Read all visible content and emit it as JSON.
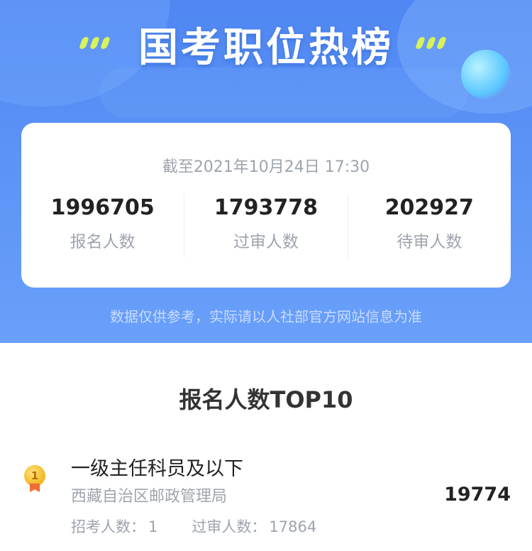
{
  "header": {
    "title": "国考职位热榜"
  },
  "summary": {
    "timestamp": "截至2021年10月24日 17:30",
    "stats": [
      {
        "value": "1996705",
        "label": "报名人数"
      },
      {
        "value": "1793778",
        "label": "过审人数"
      },
      {
        "value": "202927",
        "label": "待审人数"
      }
    ],
    "disclaimer": "数据仅供参考，实际请以人社部官方网站信息为准"
  },
  "ranking": {
    "title": "报名人数TOP10",
    "items": [
      {
        "rank": "1",
        "position": "一级主任科员及以下",
        "organization": "西藏自治区邮政管理局",
        "recruit_label": "招考人数：",
        "recruit_count": "1",
        "approved_label": "过审人数：",
        "approved_count": "17864",
        "applicants": "19774"
      }
    ]
  },
  "colors": {
    "hero_blue": "#5b93f6",
    "accent_yellow": "#d8f25a",
    "medal_gold": "#f2b51f"
  }
}
